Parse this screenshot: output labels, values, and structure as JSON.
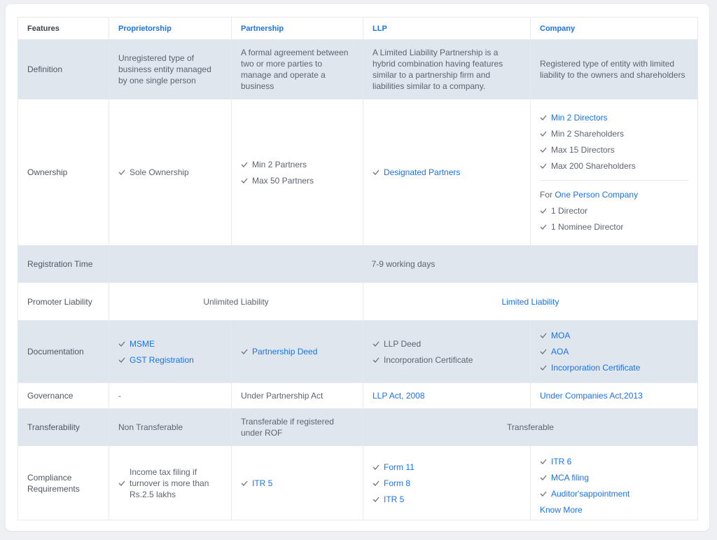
{
  "headers": [
    "Features",
    "Proprietorship",
    "Partnership",
    "LLP",
    "Company"
  ],
  "definition": {
    "label": "Definition",
    "proprietorship": "Unregistered type of business entity managed by one single person",
    "partnership": "A formal agreement between two or more parties to manage and operate a business",
    "llp": "A Limited Liability Partnership is a hybrid combination having features similar to a partnership firm and liabilities similar to a company.",
    "company": "Registered type of entity with limited liability to the owners and shareholders"
  },
  "ownership": {
    "label": "Ownership",
    "proprietorship": [
      "Sole Ownership"
    ],
    "partnership": [
      "Min 2 Partners",
      "Max 50 Partners"
    ],
    "llp": [
      "Designated Partners"
    ],
    "company": [
      "Min 2 Directors",
      "Min 2 Shareholders",
      "Max 15 Directors",
      "Max 200 Shareholders"
    ],
    "opc_prefix": "For",
    "opc_link": "One Person Company",
    "opc_items": [
      "1 Director",
      "1 Nominee Director"
    ]
  },
  "registration": {
    "label": "Registration Time",
    "value": "7-9 working days"
  },
  "liability": {
    "label": "Promoter Liability",
    "unlimited": "Unlimited Liability",
    "limited": "Limited Liability"
  },
  "documentation": {
    "label": "Documentation",
    "proprietorship": [
      "MSME",
      "GST Registration"
    ],
    "partnership": [
      "Partnership Deed"
    ],
    "llp": [
      "LLP Deed",
      "Incorporation Certificate"
    ],
    "company": [
      "MOA",
      "AOA",
      "Incorporation Certificate"
    ]
  },
  "governance": {
    "label": "Governance",
    "proprietorship": "-",
    "partnership": "Under Partnership Act",
    "llp": "LLP Act, 2008",
    "company": "Under Companies Act,2013"
  },
  "transferability": {
    "label": "Transferability",
    "proprietorship": "Non Transferable",
    "partnership": "Transferable if registered under ROF",
    "rest": "Transferable"
  },
  "compliance": {
    "label": "Compliance Requirements",
    "proprietorship": [
      "Income tax filing if turnover is more than Rs.2.5 lakhs"
    ],
    "partnership": [
      "ITR 5"
    ],
    "llp": [
      "Form 11",
      "Form 8",
      "ITR 5"
    ],
    "company": [
      "ITR 6",
      "MCA filing",
      "Auditor'sappointment"
    ],
    "know_more": "Know More"
  },
  "colors": {
    "accent": "#1a73e8",
    "row_shade": "#dfe6ee",
    "text": "#5c6470"
  }
}
